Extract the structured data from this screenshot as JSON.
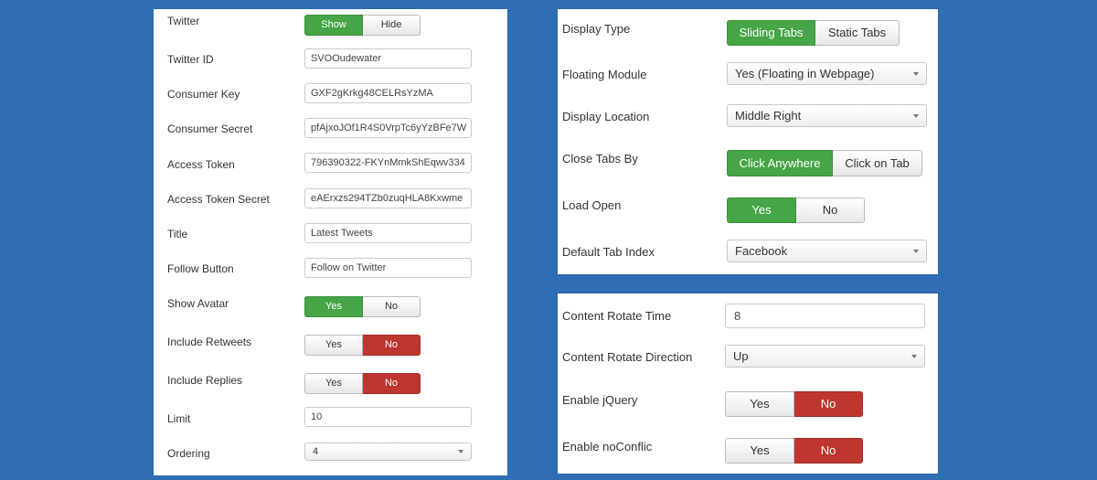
{
  "left_panel": {
    "twitter": {
      "label": "Twitter",
      "options": [
        "Show",
        "Hide"
      ]
    },
    "twitter_id": {
      "label": "Twitter ID",
      "value": "SVOOudewater"
    },
    "consumer_key": {
      "label": "Consumer Key",
      "value": "GXF2gKrkg48CELRsYzMA"
    },
    "consumer_secret": {
      "label": "Consumer Secret",
      "value": "pfAjxoJOf1R4S0VrpTc6yYzBFe7W"
    },
    "access_token": {
      "label": "Access Token",
      "value": "796390322-FKYnMmkShEqwv334"
    },
    "access_token_secret": {
      "label": "Access Token Secret",
      "value": "eAErxzs294TZb0zuqHLA8Kxwme"
    },
    "title": {
      "label": "Title",
      "value": "Latest Tweets"
    },
    "follow_button": {
      "label": "Follow Button",
      "value": "Follow on Twitter"
    },
    "show_avatar": {
      "label": "Show Avatar",
      "options": [
        "Yes",
        "No"
      ]
    },
    "include_retweets": {
      "label": "Include Retweets",
      "options": [
        "Yes",
        "No"
      ]
    },
    "include_replies": {
      "label": "Include Replies",
      "options": [
        "Yes",
        "No"
      ]
    },
    "limit": {
      "label": "Limit",
      "value": "10"
    },
    "ordering": {
      "label": "Ordering",
      "value": "4"
    }
  },
  "top_right_panel": {
    "display_type": {
      "label": "Display Type",
      "options": [
        "Sliding Tabs",
        "Static Tabs"
      ]
    },
    "floating_module": {
      "label": "Floating Module",
      "value": "Yes (Floating in Webpage)"
    },
    "display_location": {
      "label": "Display Location",
      "value": "Middle Right"
    },
    "close_tabs_by": {
      "label": "Close Tabs By",
      "options": [
        "Click Anywhere",
        "Click on Tab"
      ]
    },
    "load_open": {
      "label": "Load Open",
      "options": [
        "Yes",
        "No"
      ]
    },
    "default_tab_index": {
      "label": "Default Tab Index",
      "value": "Facebook"
    }
  },
  "bottom_right_panel": {
    "content_rotate_time": {
      "label": "Content Rotate Time",
      "value": "8"
    },
    "content_rotate_direction": {
      "label": "Content Rotate Direction",
      "value": "Up"
    },
    "enable_jquery": {
      "label": "Enable jQuery",
      "options": [
        "Yes",
        "No"
      ]
    },
    "enable_noconflict": {
      "label": "Enable noConflic",
      "options": [
        "Yes",
        "No"
      ]
    }
  },
  "colors": {
    "background": "#2f6db5",
    "active_green": "#46a546",
    "active_red": "#bd362f"
  }
}
